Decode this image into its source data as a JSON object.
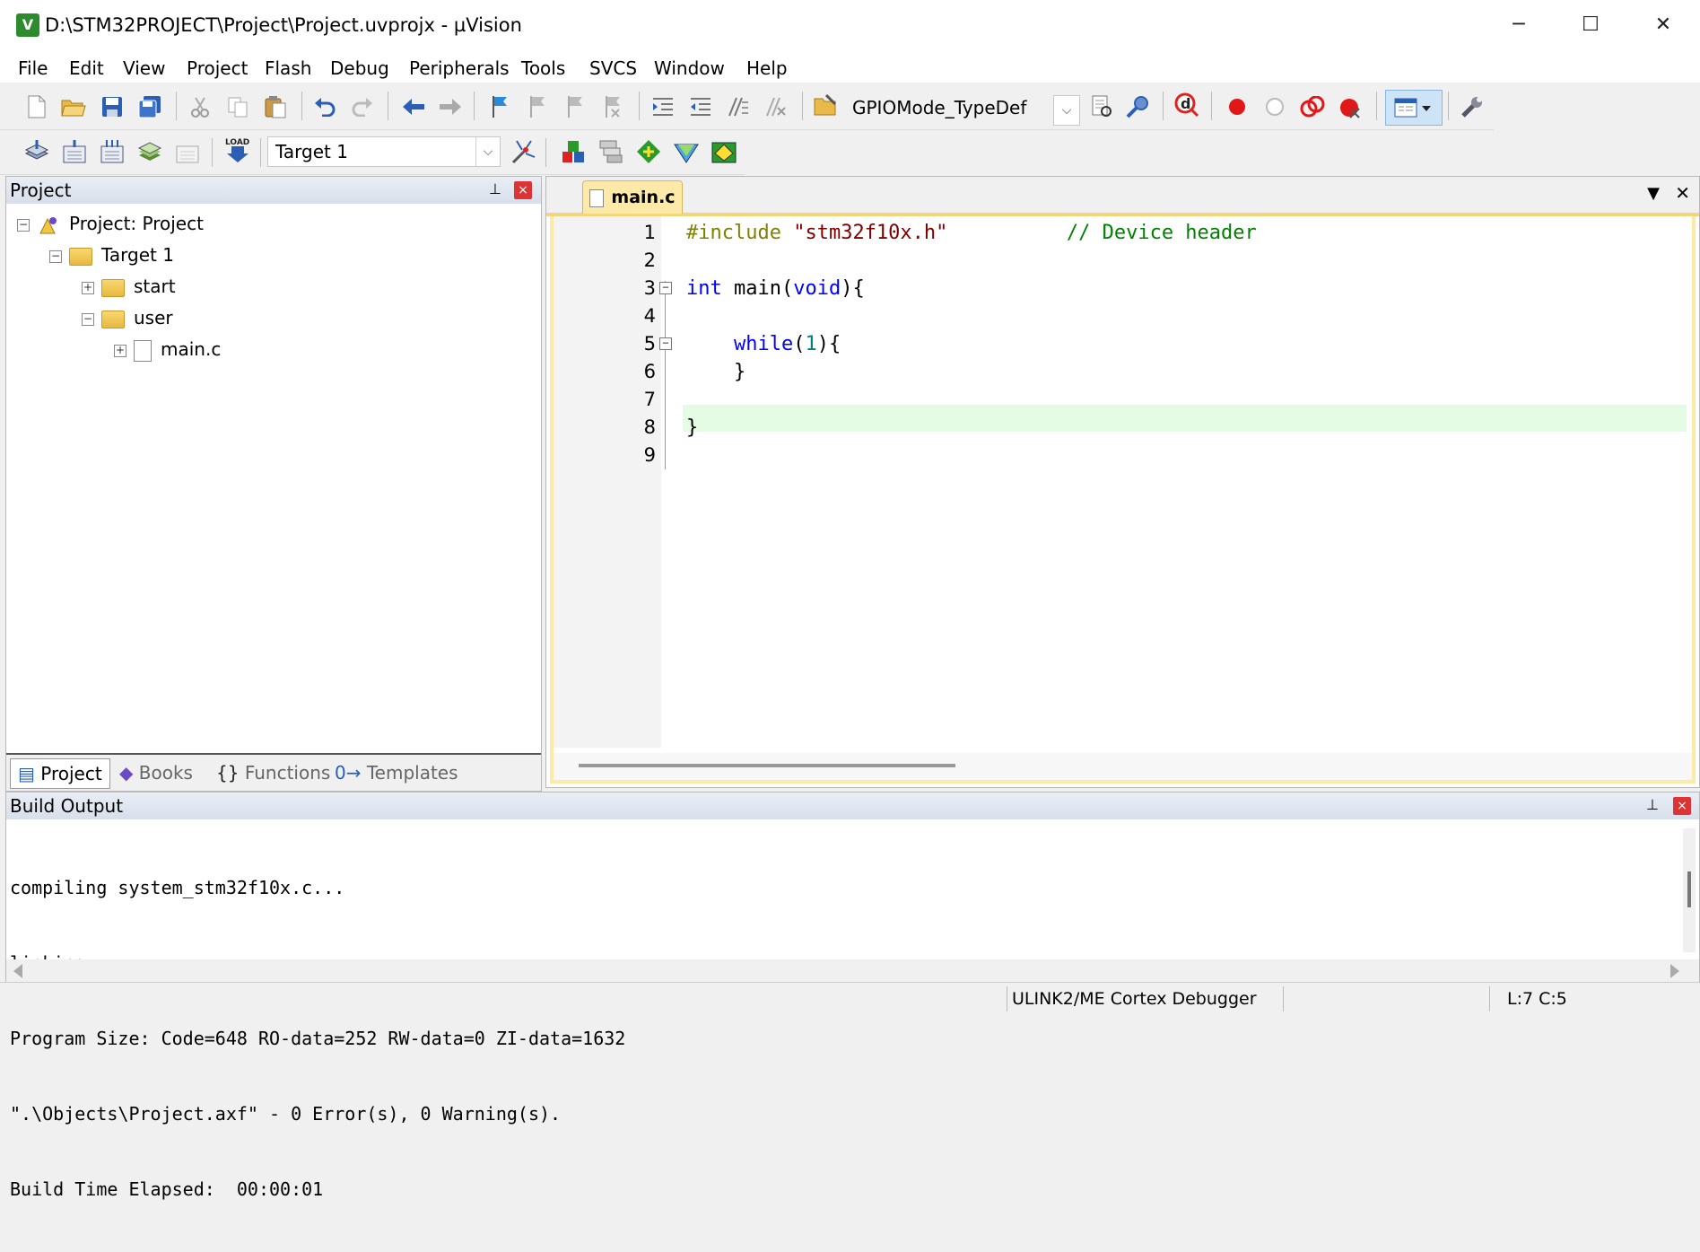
{
  "window": {
    "title": "D:\\STM32PROJECT\\Project\\Project.uvprojx - µVision",
    "app_icon_glyph": "V",
    "minimize": "─",
    "maximize": "☐",
    "close": "✕"
  },
  "menu": [
    "File",
    "Edit",
    "View",
    "Project",
    "Flash",
    "Debug",
    "Peripherals",
    "Tools",
    "SVCS",
    "Window",
    "Help"
  ],
  "toolbar": {
    "find_combo": "GPIOMode_TypeDef",
    "target_combo": "Target 1"
  },
  "project_panel": {
    "title": "Project",
    "tree": {
      "root": "Project: Project",
      "target": "Target 1",
      "group_start": "start",
      "group_user": "user",
      "file_main": "main.c"
    },
    "tabs": [
      "Project",
      "Books",
      "Functions",
      "Templates"
    ],
    "tab_glyphs": [
      "▤",
      "◆",
      "{}",
      "0→"
    ]
  },
  "editor": {
    "tab": "main.c",
    "line_numbers": [
      "1",
      "2",
      "3",
      "4",
      "5",
      "6",
      "7",
      "8",
      "9"
    ],
    "lines": {
      "l1_pp": "#include",
      "l1_str": "\"stm32f10x.h\"",
      "l1_cmt": "// Device header",
      "l3_kw": "int",
      "l3_name": "main",
      "l3_open": "(",
      "l3_void": "void",
      "l3_close": "){",
      "l5_kw": "while",
      "l5_open": "(",
      "l5_num": "1",
      "l5_close": "){",
      "l6": "}",
      "l8": "}"
    },
    "pane_dropdown": "▼",
    "pane_close": "✕"
  },
  "build_output": {
    "title": "Build Output",
    "lines": [
      "compiling system_stm32f10x.c...",
      "linking...",
      "Program Size: Code=648 RO-data=252 RW-data=0 ZI-data=1632",
      "\".\\Objects\\Project.axf\" - 0 Error(s), 0 Warning(s).",
      "Build Time Elapsed:  00:00:01"
    ]
  },
  "status": {
    "debugger": "ULINK2/ME Cortex Debugger",
    "cursor": "L:7 C:5"
  },
  "panel_controls": {
    "pin": "⊥",
    "close": "×"
  }
}
